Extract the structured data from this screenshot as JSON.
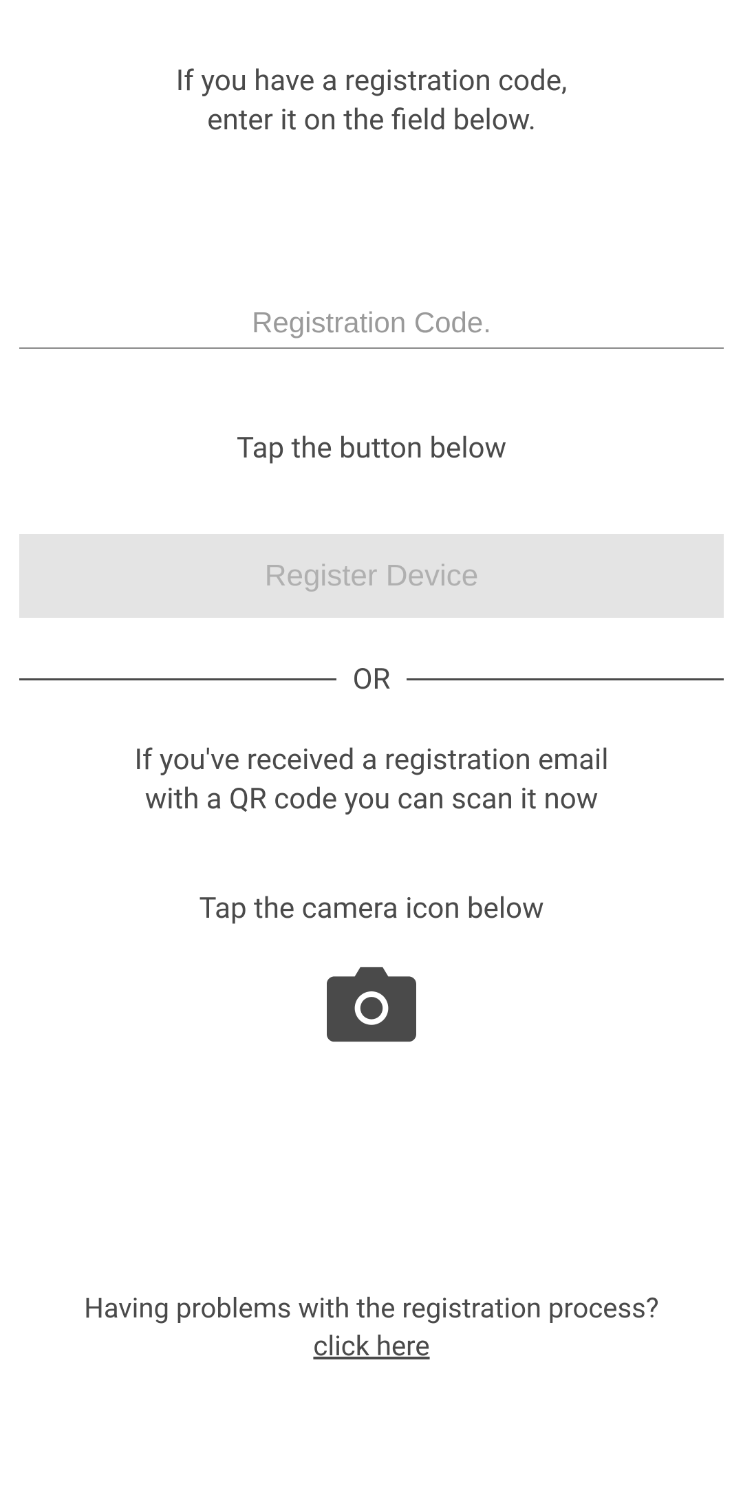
{
  "intro": {
    "line1": "If you have a registration code,",
    "line2": "enter it on the field below."
  },
  "input": {
    "placeholder": "Registration Code."
  },
  "tap_button_label": "Tap the button below",
  "register_button_label": "Register Device",
  "divider_label": "OR",
  "qr": {
    "line1": "If you've received a registration email",
    "line2": "with a QR code you can scan it now"
  },
  "camera_label": "Tap the camera icon below",
  "footer": {
    "problems_text": "Having problems with the registration process?",
    "link_text": "click here"
  }
}
